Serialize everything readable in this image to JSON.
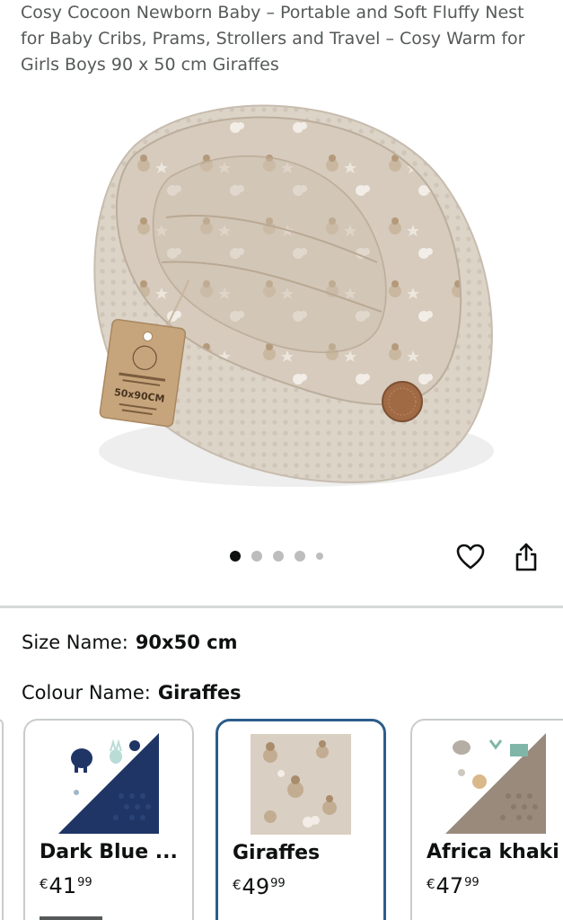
{
  "product": {
    "title": "Cosy Cocoon Newborn Baby – Portable and Soft Fluffy Nest for Baby Cribs, Prams, Strollers and Travel – Cosy Warm for Girls Boys 90 x 50 cm Giraffes",
    "tag_text": "50x90CM"
  },
  "gallery": {
    "image_count": 5,
    "active_index": 0
  },
  "actions": {
    "wishlist_icon": "heart-icon",
    "share_icon": "share-icon"
  },
  "specs": {
    "size_label": "Size Name:",
    "size_value": "90x50 cm",
    "colour_label": "Colour Name:",
    "colour_value": "Giraffes"
  },
  "swatches": [
    {
      "name": "Dark Blue ...",
      "currency": "€",
      "whole": "41",
      "fraction": "99",
      "selected": false
    },
    {
      "name": "Giraffes",
      "currency": "€",
      "whole": "49",
      "fraction": "99",
      "selected": true
    },
    {
      "name": "Africa khaki",
      "currency": "€",
      "whole": "47",
      "fraction": "99",
      "selected": false
    }
  ],
  "colors": {
    "selected_border": "#2d5d8a",
    "nest_beige": "#d9cfc2",
    "dark_blue": "#1f3566",
    "khaki": "#9a8a7c"
  }
}
